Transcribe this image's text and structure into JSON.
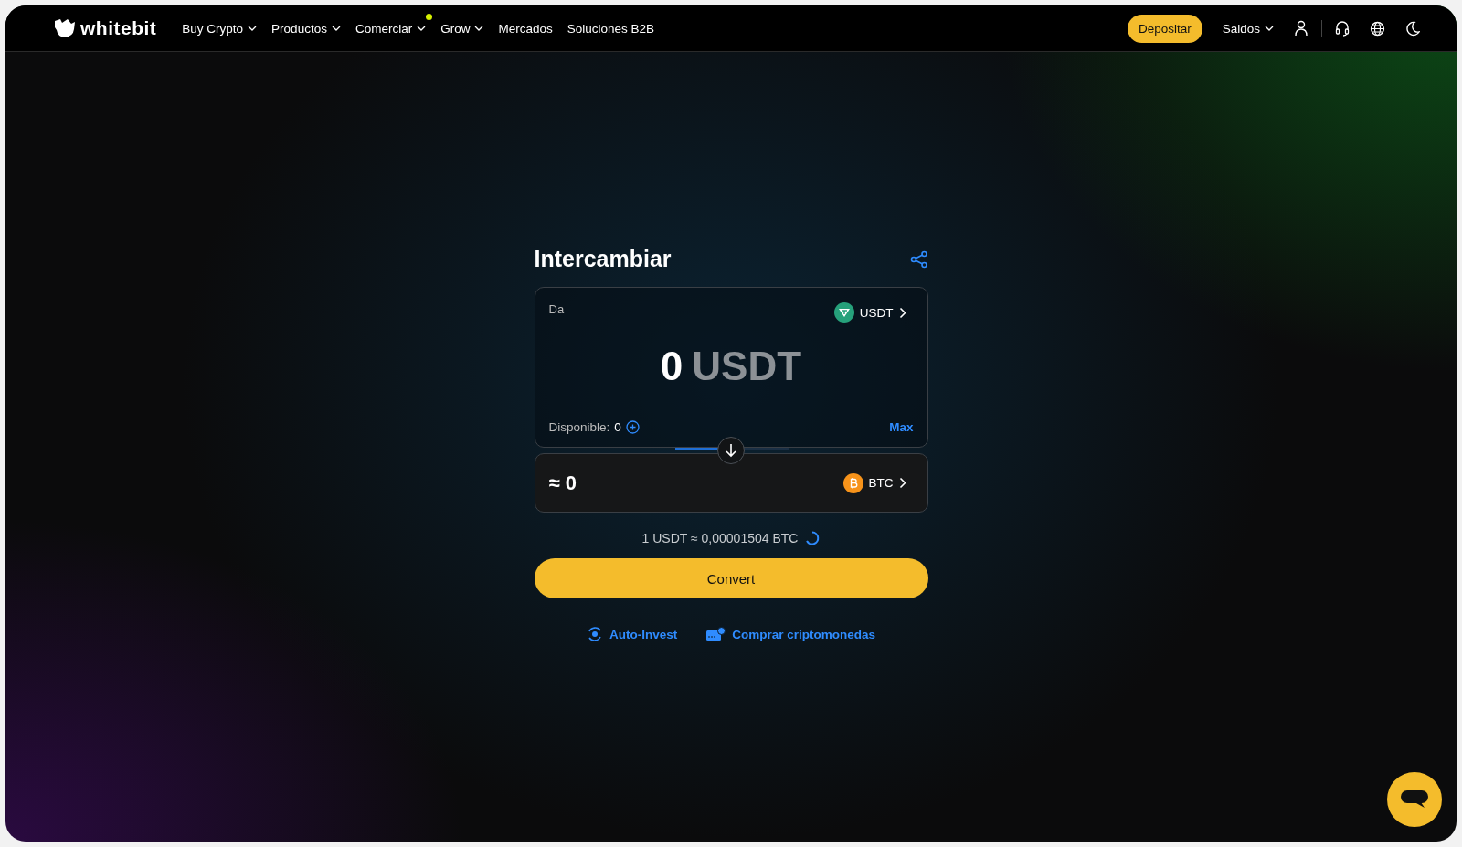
{
  "nav": {
    "logo": "whitebit",
    "items": [
      {
        "label": "Buy Crypto",
        "has_dropdown": true,
        "notification": false
      },
      {
        "label": "Productos",
        "has_dropdown": true,
        "notification": false
      },
      {
        "label": "Comerciar",
        "has_dropdown": true,
        "notification": true
      },
      {
        "label": "Grow",
        "has_dropdown": true,
        "notification": false
      },
      {
        "label": "Mercados",
        "has_dropdown": false,
        "notification": false
      },
      {
        "label": "Soluciones B2B",
        "has_dropdown": false,
        "notification": false
      }
    ],
    "deposit_button": "Depositar",
    "balances": "Saldos"
  },
  "swap": {
    "title": "Intercambiar",
    "from": {
      "label": "Da",
      "currency": "USDT",
      "amount": "0",
      "amount_currency": "USDT",
      "available_label": "Disponible:",
      "available": "0",
      "max": "Max"
    },
    "refresh": {
      "level": 0.45
    },
    "to": {
      "amount": "≈ 0",
      "currency": "BTC"
    },
    "rate": "1 USDT ≈ 0,00001504 BTC",
    "convert": "Convert",
    "links": [
      {
        "kind": "auto-invest",
        "label": "Auto-Invest"
      },
      {
        "kind": "buy-crypto",
        "label": "Comprar criptomonedas"
      }
    ]
  }
}
